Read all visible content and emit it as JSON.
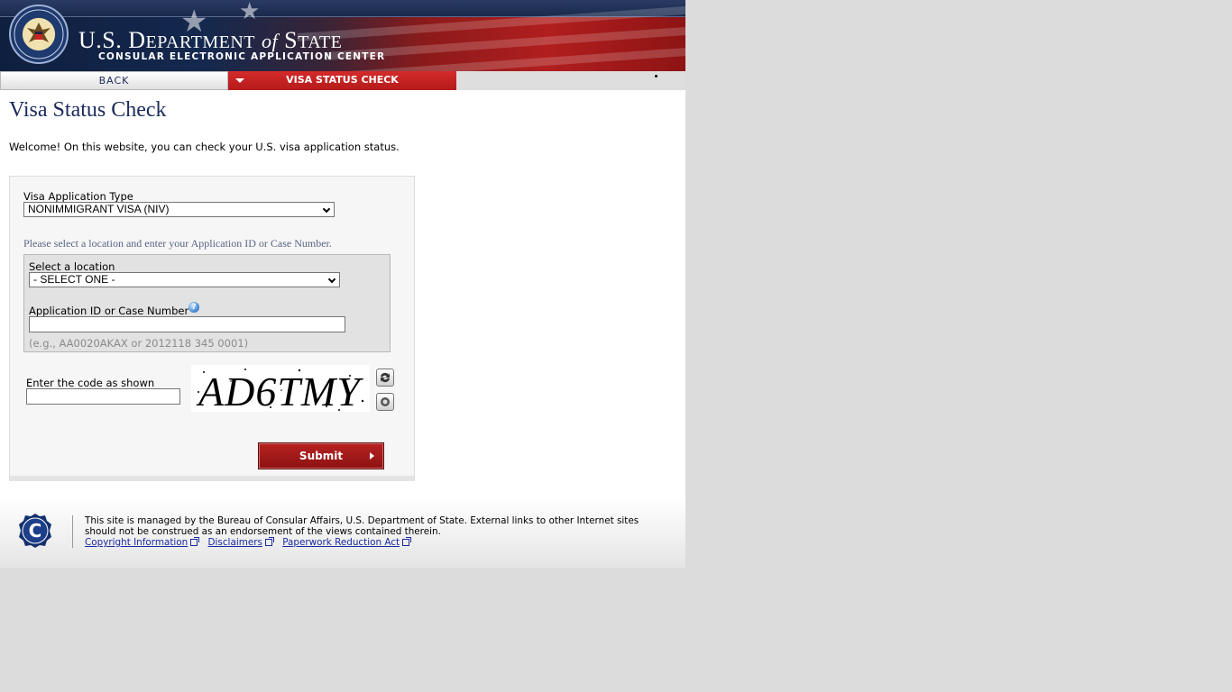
{
  "header": {
    "dept_title_us": "U.S. D",
    "dept_title_epartment": "EPARTMENT",
    "dept_title_of": "of",
    "dept_title_s": "S",
    "dept_title_tate": "TATE",
    "subtitle": "CONSULAR ELECTRONIC APPLICATION CENTER",
    "seal_icon": "department-of-state-seal-icon",
    "colors": {
      "navy": "#14284e",
      "red": "#b11e1e"
    }
  },
  "nav": {
    "back_label": "BACK",
    "active_label": "VISA STATUS CHECK",
    "active_color": "#c42222"
  },
  "main": {
    "title": "Visa Status Check",
    "welcome": "Welcome! On this website, you can check your U.S. visa application status."
  },
  "form": {
    "visa_type_label": "Visa Application Type",
    "visa_type_value": "NONIMMIGRANT VISA (NIV)",
    "instruction": "Please select a location and enter your Application ID or Case Number.",
    "location_label": "Select a location",
    "location_value": "- SELECT ONE -",
    "app_id_label": "Application ID or Case Number",
    "help_icon": "help-question-icon",
    "app_id_value": "",
    "example": "(e.g., AA0020AKAX or 2012118 345 0001)",
    "code_label": "Enter the code as shown",
    "code_value": "",
    "captcha_text": "AD6TMY",
    "refresh_icon": "refresh-icon",
    "audio_icon": "audio-icon",
    "submit_label": "Submit"
  },
  "footer": {
    "logo_icon": "consular-c-logo-icon",
    "text": "This site is managed by the Bureau of Consular Affairs, U.S. Department of State. External links to other Internet sites should not be construed as an endorsement of the views contained therein.",
    "links": [
      "Copyright Information",
      "Disclaimers",
      "Paperwork Reduction Act"
    ],
    "link_icon": "external-link-icon"
  }
}
